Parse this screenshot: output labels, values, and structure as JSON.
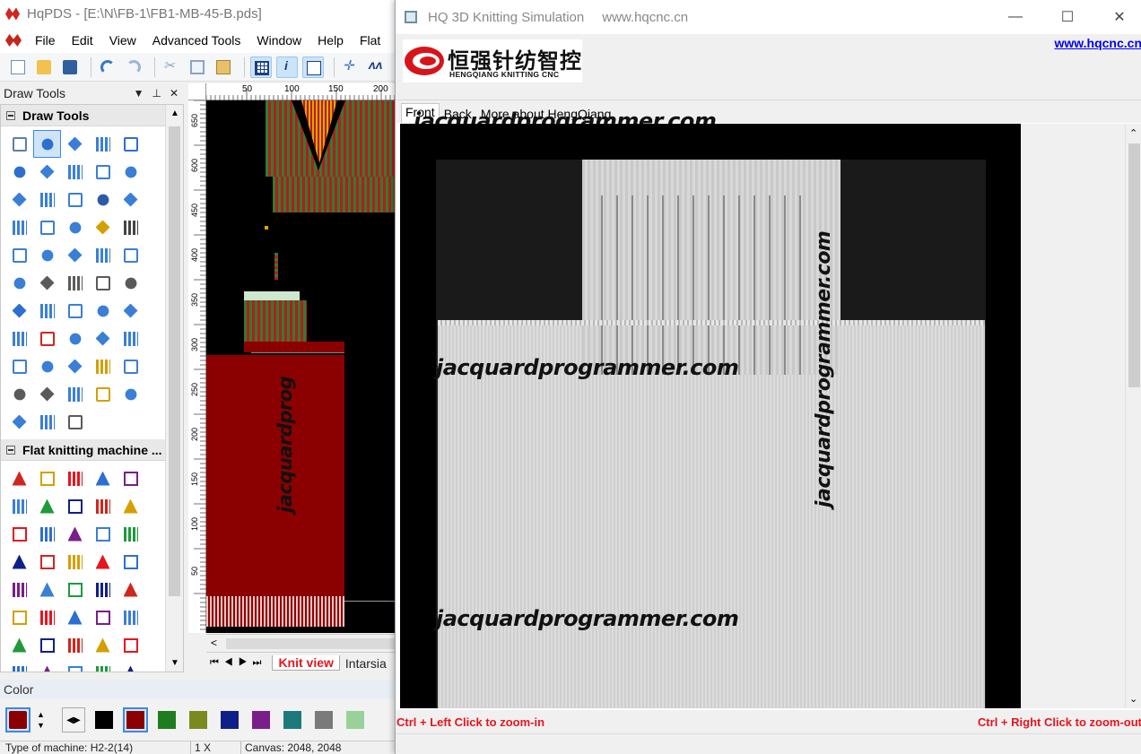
{
  "main": {
    "title": "HqPDS - [E:\\N\\FB-1\\FB1-MB-45-B.pds]",
    "menu": [
      "File",
      "Edit",
      "View",
      "Advanced Tools",
      "Window",
      "Help",
      "Flat"
    ],
    "draw_tools_header": "Draw Tools",
    "groups": {
      "draw_tools": "Draw Tools",
      "flat_knitting": "Flat knitting machine ..."
    },
    "ruler_top": [
      "50",
      "100",
      "150",
      "200"
    ],
    "ruler_left": [
      "650",
      "600",
      "450",
      "400",
      "350",
      "300",
      "250",
      "200",
      "150",
      "100",
      "50"
    ],
    "tabs": {
      "active": "Knit view",
      "next": "Intarsia"
    },
    "color_title": "Color",
    "status": {
      "machine": "Type of machine: H2-2(14)",
      "zoom": "1 X",
      "canvas": "Canvas: 2048, 2048"
    },
    "canvas_watermark": "jacquardprog"
  },
  "sim": {
    "title": "HQ 3D Knitting Simulation",
    "title_url": "www.hqcnc.cn",
    "link": "www.hqcnc.cn",
    "logo_cn": "恒强针纺智控",
    "logo_en": "HENGQIANG KNITTING CNC",
    "tabs": [
      "Front",
      "Back",
      "More about HengQiang"
    ],
    "watermark": "jacquardprogrammer.com",
    "footer_left": "Ctrl + Left Click to zoom-in",
    "footer_right": "Ctrl + Right Click to zoom-out"
  },
  "colors": {
    "accent_red": "#e8141e",
    "knit_red": "#8b0000",
    "knit_green": "#2e7d32",
    "sim_fabric": "#d9d9d9"
  }
}
